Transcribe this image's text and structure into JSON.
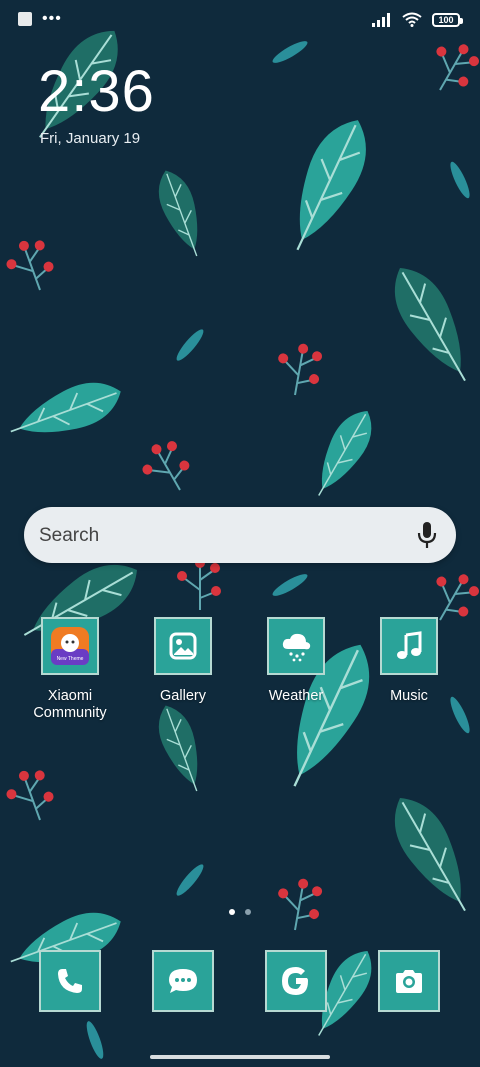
{
  "status_bar": {
    "battery": "100",
    "icons": [
      "square-notification-icon",
      "more-dots-icon",
      "signal-icon",
      "wifi-icon",
      "battery-icon"
    ]
  },
  "clock": {
    "time": "2:36",
    "date": "Fri, January 19"
  },
  "search": {
    "placeholder": "Search",
    "mic_icon": "mic-icon"
  },
  "apps": [
    {
      "label": "Xiaomi\nCommunity",
      "icon": "xiaomi-community-icon"
    },
    {
      "label": "Gallery",
      "icon": "gallery-icon"
    },
    {
      "label": "Weather",
      "icon": "weather-icon"
    },
    {
      "label": "Music",
      "icon": "music-icon"
    }
  ],
  "dock": [
    {
      "name": "phone",
      "icon": "phone-icon"
    },
    {
      "name": "messages",
      "icon": "messages-icon"
    },
    {
      "name": "google",
      "icon": "google-icon"
    },
    {
      "name": "camera",
      "icon": "camera-icon"
    }
  ],
  "page_indicator": {
    "count": 2,
    "active": 1
  },
  "colors": {
    "background": "#0f2a3c",
    "leaf": "#2aa399",
    "tile": "#2aa399",
    "berry": "#d9353e"
  }
}
